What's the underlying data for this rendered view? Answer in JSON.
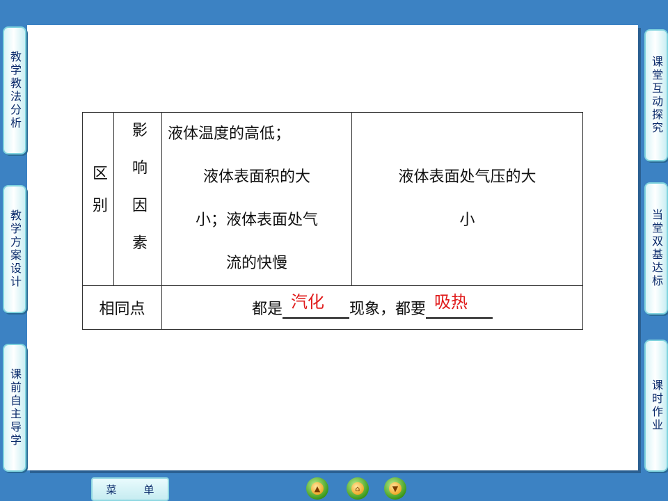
{
  "left_tabs": [
    "教学教法分析",
    "教学方案设计",
    "课前自主导学"
  ],
  "right_tabs": [
    "课堂互动探究",
    "当堂双基达标",
    "课时作业"
  ],
  "table": {
    "row_label": "区别",
    "factor_label": "影响因素",
    "evaporation_factors": [
      "液体温度的高低；",
      "液体表面积的大",
      "小；液体表面处气",
      "流的快慢"
    ],
    "boiling_factors": [
      "液体表面处气压的大",
      "小"
    ],
    "common_label": "相同点",
    "common_text": {
      "part1": "都是",
      "answer1": "汽化",
      "part2": "现象，都要",
      "answer2": "吸热"
    }
  },
  "menu": {
    "left": "菜",
    "right": "单"
  },
  "nav_icons": [
    "arrow-up-icon",
    "home-icon",
    "arrow-down-icon"
  ],
  "colors": {
    "background": "#3c82c3",
    "answer": "#e01b1b"
  }
}
